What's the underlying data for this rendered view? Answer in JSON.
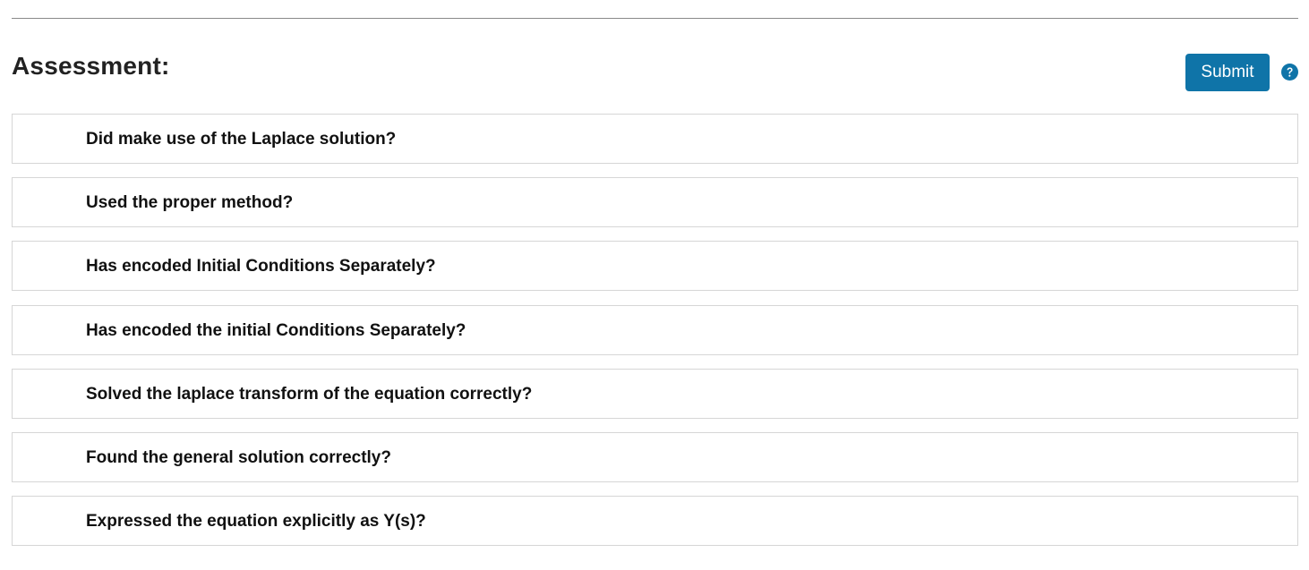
{
  "header": {
    "title": "Assessment:",
    "submit_label": "Submit",
    "help_icon": "question-circle-icon"
  },
  "colors": {
    "accent": "#0f74a8",
    "row_border": "#d6d6d6",
    "divider": "#8a8a8a"
  },
  "criteria": [
    {
      "label": "Did make use of the Laplace solution?"
    },
    {
      "label": "Used the proper method?"
    },
    {
      "label": "Has encoded Initial Conditions Separately?"
    },
    {
      "label": "Has encoded the initial Conditions Separately?"
    },
    {
      "label": "Solved the laplace transform of the equation correctly?"
    },
    {
      "label": "Found the general solution correctly?"
    },
    {
      "label": "Expressed the equation explicitly as Y(s)?"
    }
  ]
}
